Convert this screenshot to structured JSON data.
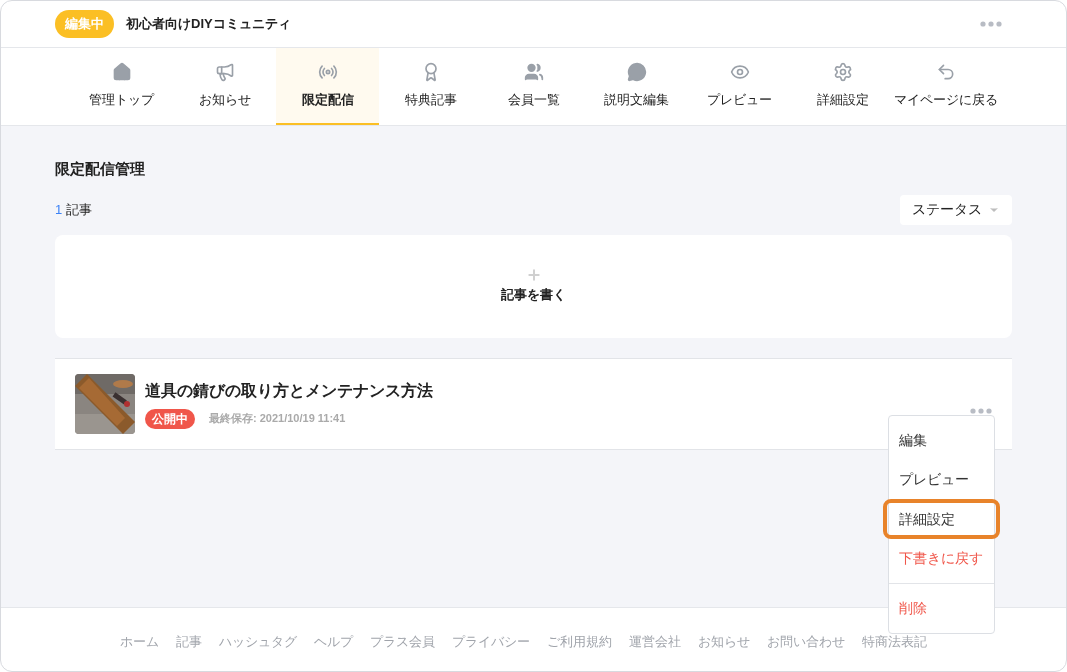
{
  "header": {
    "badge": "編集中",
    "title": "初心者向けDIYコミュニティ"
  },
  "nav": [
    {
      "label": "管理トップ",
      "selected": false
    },
    {
      "label": "お知らせ",
      "selected": false
    },
    {
      "label": "限定配信",
      "selected": true
    },
    {
      "label": "特典記事",
      "selected": false
    },
    {
      "label": "会員一覧",
      "selected": false
    },
    {
      "label": "説明文編集",
      "selected": false
    },
    {
      "label": "プレビュー",
      "selected": false
    },
    {
      "label": "詳細設定",
      "selected": false
    },
    {
      "label": "マイページに戻る",
      "selected": false
    }
  ],
  "page_title": "限定配信管理",
  "count": {
    "number": "1",
    "unit": "記事"
  },
  "status_filter": "ステータス",
  "new_article": "記事を書く",
  "articles": [
    {
      "kind": "picture",
      "title": "道具の錆びの取り方とメンテナンス方法",
      "status": "公開中",
      "saved": "最終保存: 2021/10/19 11:41"
    }
  ],
  "menu": [
    {
      "label": "編集",
      "danger": false,
      "highlighted": false,
      "divider_before": false
    },
    {
      "label": "プレビュー",
      "danger": false,
      "highlighted": false,
      "divider_before": false
    },
    {
      "label": "詳細設定",
      "danger": false,
      "highlighted": true,
      "divider_before": false
    },
    {
      "label": "下書きに戻す",
      "danger": true,
      "highlighted": false,
      "divider_before": false
    },
    {
      "label": "削除",
      "danger": true,
      "highlighted": false,
      "divider_before": true
    }
  ],
  "footer": [
    "ホーム",
    "記事",
    "ハッシュタグ",
    "ヘルプ",
    "プラス会員",
    "プライバシー",
    "ご利用規約",
    "運営会社",
    "お知らせ",
    "お問い合わせ",
    "特商法表記"
  ]
}
